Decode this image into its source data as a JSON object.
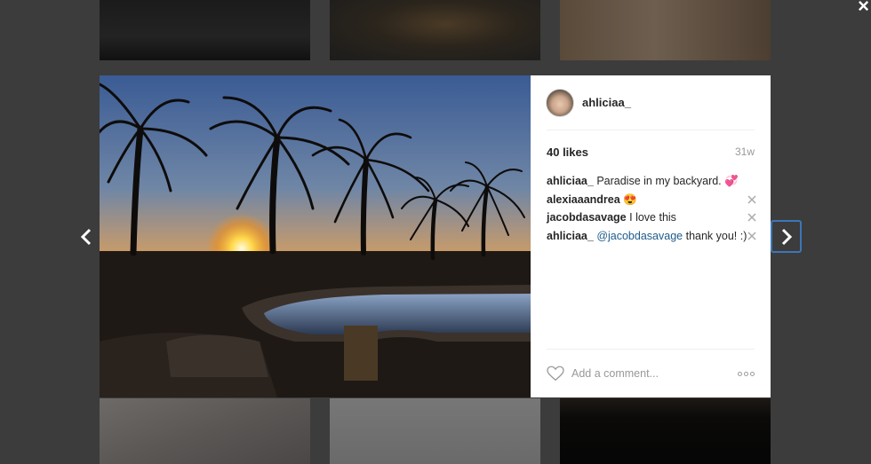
{
  "post": {
    "username": "ahliciaa_",
    "likes": "40 likes",
    "age": "31w",
    "caption": {
      "user": "ahliciaa_",
      "text": "Paradise in my backyard. 💞"
    },
    "comments": [
      {
        "user": "alexiaaandrea",
        "text": "😍"
      },
      {
        "user": "jacobdasavage",
        "text": "I love this"
      },
      {
        "user": "ahliciaa_",
        "mention": "@jacobdasavage",
        "text": "thank you! :)"
      }
    ],
    "add_comment_placeholder": "Add a comment..."
  },
  "controls": {
    "close_label": "×"
  },
  "colors": {
    "backdrop": "#3c3c3c",
    "mention": "#1e5c8c",
    "focus_ring": "#3d76b8"
  }
}
